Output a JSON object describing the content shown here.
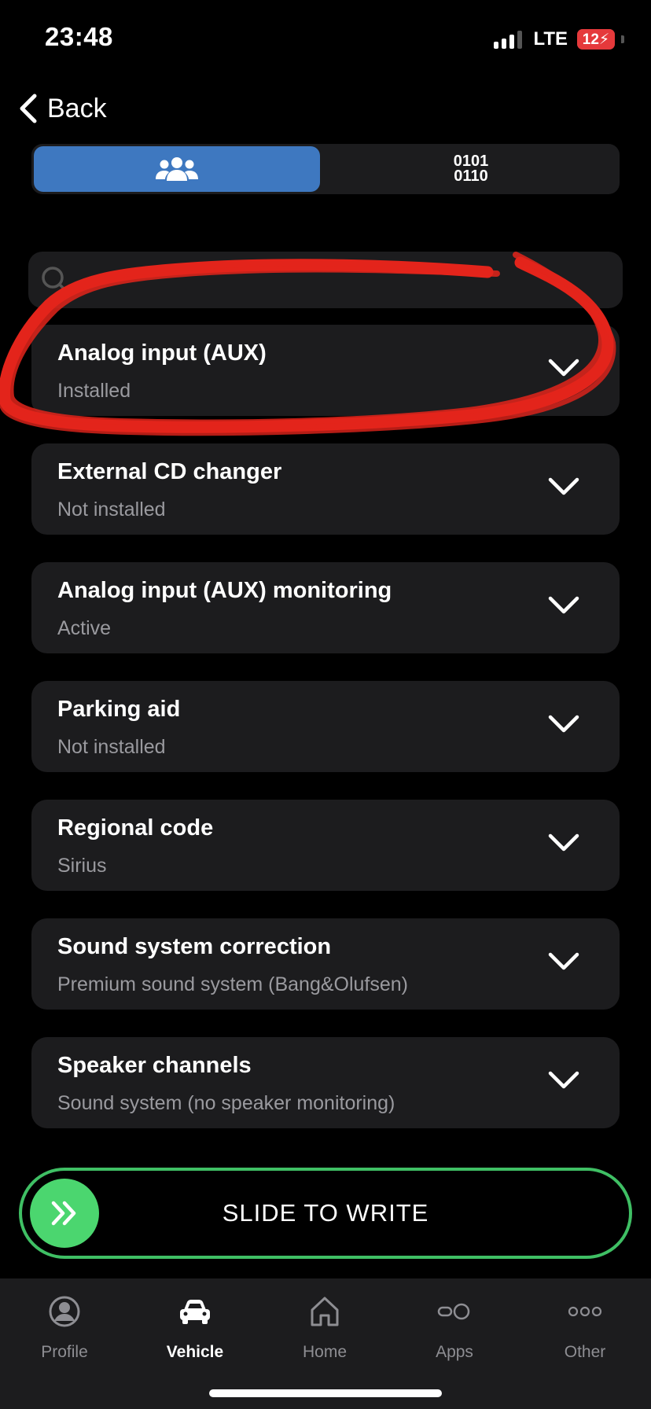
{
  "status_bar": {
    "time": "23:48",
    "network": "LTE",
    "battery": "12",
    "battery_level": 0.12,
    "colors": {
      "battery_low": "#e5393b"
    }
  },
  "nav": {
    "back_label": "Back"
  },
  "segmented": {
    "icons": [
      "people-icon",
      "binary-icon"
    ],
    "binary_top": "0101",
    "binary_bottom": "0110",
    "selected": 0
  },
  "search": {
    "placeholder": "",
    "value": ""
  },
  "options": [
    {
      "title": "Analog input (AUX)",
      "value": "Installed"
    },
    {
      "title": "External CD changer",
      "value": "Not installed"
    },
    {
      "title": "Analog input (AUX) monitoring",
      "value": "Active"
    },
    {
      "title": "Parking aid",
      "value": "Not installed"
    },
    {
      "title": "Regional code",
      "value": "Sirius"
    },
    {
      "title": "Sound system correction",
      "value": "Premium sound system (Bang&Olufsen)"
    },
    {
      "title": "Speaker channels",
      "value": "Sound system (no speaker monitoring)"
    }
  ],
  "slider": {
    "label": "SLIDE TO WRITE",
    "color": "#3fbf64"
  },
  "tabbar": {
    "items": [
      {
        "label": "Profile",
        "icon": "profile-icon"
      },
      {
        "label": "Vehicle",
        "icon": "car-icon"
      },
      {
        "label": "Home",
        "icon": "home-icon"
      },
      {
        "label": "Apps",
        "icon": "apps-icon"
      },
      {
        "label": "Other",
        "icon": "more-icon"
      }
    ],
    "active": "Vehicle"
  },
  "colors": {
    "accent": "#3e78c0",
    "card": "#1c1c1e",
    "annotation": "#e3241b"
  }
}
